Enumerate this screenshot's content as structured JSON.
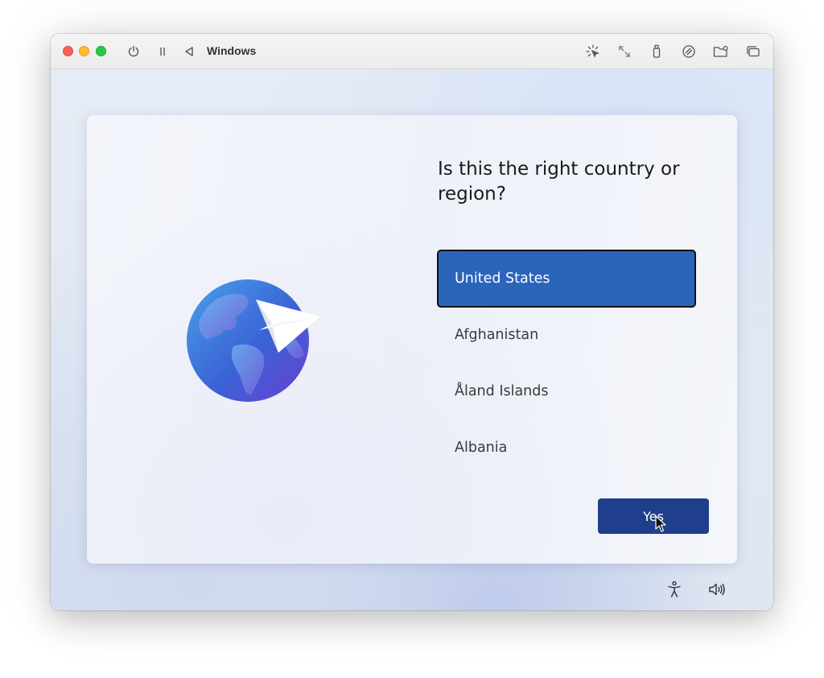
{
  "window": {
    "title": "Windows",
    "toolbar_icons": [
      "power-icon",
      "pause-icon",
      "back-icon",
      "capture-cursor-icon",
      "resize-icon",
      "usb-icon",
      "network-icon",
      "shared-folder-icon",
      "windows-icon"
    ]
  },
  "setup": {
    "question": "Is this the right country or region?",
    "countries": [
      {
        "label": "United States",
        "selected": true
      },
      {
        "label": "Afghanistan",
        "selected": false
      },
      {
        "label": "Åland Islands",
        "selected": false
      },
      {
        "label": "Albania",
        "selected": false
      }
    ],
    "confirm_label": "Yes"
  },
  "taskbar": {
    "icons": [
      "accessibility-icon",
      "volume-icon"
    ]
  },
  "colors": {
    "selected_bg": "#2b64bb",
    "button_bg": "#1f3f8c"
  }
}
